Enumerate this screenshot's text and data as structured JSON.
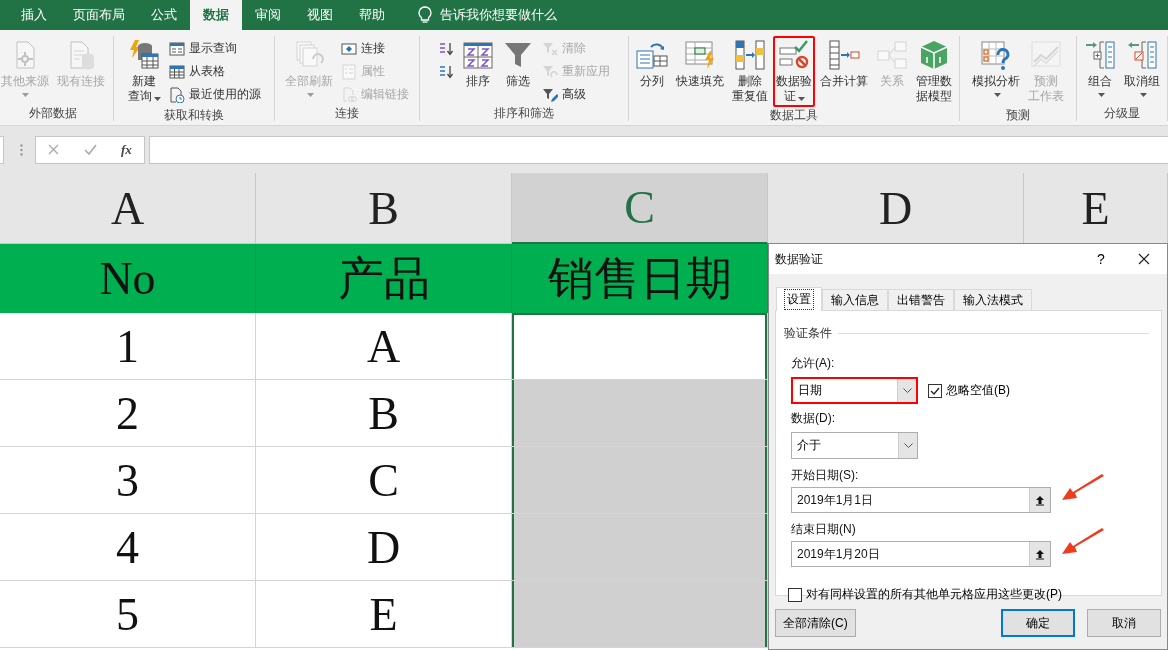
{
  "ribbon_tabs": [
    {
      "label": "插入",
      "selected": false
    },
    {
      "label": "页面布局",
      "selected": false
    },
    {
      "label": "公式",
      "selected": false
    },
    {
      "label": "数据",
      "selected": true
    },
    {
      "label": "审阅",
      "selected": false
    },
    {
      "label": "视图",
      "selected": false
    },
    {
      "label": "帮助",
      "selected": false
    }
  ],
  "tell_me": "告诉我你想要做什么",
  "ribbon_groups": [
    {
      "label": "外部数据",
      "items": [
        {
          "kind": "large",
          "label": "其他来源",
          "disabled": true,
          "dropdown": true,
          "highlighted": false
        },
        {
          "kind": "large",
          "label": "现有连接",
          "disabled": true,
          "dropdown": false,
          "highlighted": false
        }
      ]
    },
    {
      "label": "获取和转换",
      "items": [
        {
          "kind": "large",
          "label": "新建查询",
          "disabled": false,
          "dropdown": true,
          "highlighted": false
        },
        {
          "kind": "stack",
          "buttons": [
            {
              "label": "显示查询",
              "disabled": false
            },
            {
              "label": "从表格",
              "disabled": false
            },
            {
              "label": "最近使用的源",
              "disabled": false
            }
          ]
        }
      ]
    },
    {
      "label": "连接",
      "items": [
        {
          "kind": "large",
          "label": "全部刷新",
          "disabled": true,
          "dropdown": true,
          "highlighted": false
        },
        {
          "kind": "stack",
          "buttons": [
            {
              "label": "连接",
              "disabled": false
            },
            {
              "label": "属性",
              "disabled": true
            },
            {
              "label": "编辑链接",
              "disabled": true
            }
          ]
        }
      ]
    },
    {
      "label": "排序和筛选",
      "items": [
        {
          "kind": "stack",
          "buttons": [
            {
              "disabled": false
            },
            {
              "disabled": false
            }
          ]
        },
        {
          "kind": "large",
          "label": "排序",
          "disabled": false,
          "dropdown": false,
          "highlighted": false
        },
        {
          "kind": "large",
          "label": "筛选",
          "disabled": false,
          "dropdown": false,
          "highlighted": false
        },
        {
          "kind": "stack",
          "buttons": [
            {
              "label": "清除",
              "disabled": true
            },
            {
              "label": "重新应用",
              "disabled": true
            },
            {
              "label": "高级",
              "disabled": false
            }
          ]
        }
      ]
    },
    {
      "label": "数据工具",
      "items": [
        {
          "kind": "large",
          "label": "分列",
          "disabled": false,
          "dropdown": false,
          "highlighted": false
        },
        {
          "kind": "large",
          "label": "快速填充",
          "disabled": false,
          "dropdown": false,
          "highlighted": false
        },
        {
          "kind": "large",
          "label": "删除重复值",
          "disabled": false,
          "dropdown": false,
          "highlighted": false
        },
        {
          "kind": "large",
          "label": "数据验证",
          "disabled": false,
          "dropdown": true,
          "highlighted": true
        },
        {
          "kind": "large",
          "label": "合并计算",
          "disabled": false,
          "dropdown": false,
          "highlighted": false
        },
        {
          "kind": "large",
          "label": "关系",
          "disabled": true,
          "dropdown": false,
          "highlighted": false
        },
        {
          "kind": "large",
          "label": "管理数据模型",
          "disabled": false,
          "dropdown": false,
          "highlighted": false
        }
      ]
    },
    {
      "label": "预测",
      "items": [
        {
          "kind": "large",
          "label": "模拟分析",
          "disabled": false,
          "dropdown": true,
          "highlighted": false
        },
        {
          "kind": "large",
          "label": "预测工作表",
          "disabled": true,
          "dropdown": false,
          "highlighted": false
        }
      ]
    },
    {
      "label": "分级显",
      "items": [
        {
          "kind": "large",
          "label": "组合",
          "disabled": false,
          "dropdown": true,
          "highlighted": false
        },
        {
          "kind": "large",
          "label": "取消组",
          "disabled": false,
          "dropdown": true,
          "highlighted": false
        }
      ]
    }
  ],
  "formula_bar": {
    "function_label": "fx"
  },
  "columns": [
    {
      "label": "A",
      "selected": false
    },
    {
      "label": "B",
      "selected": false
    },
    {
      "label": "C",
      "selected": true
    },
    {
      "label": "D",
      "selected": false
    },
    {
      "label": "E",
      "selected": false
    }
  ],
  "header_row": [
    "No",
    "产品",
    "销售日期"
  ],
  "rows": [
    {
      "cells": [
        "1",
        "A"
      ],
      "active": true
    },
    {
      "cells": [
        "2",
        "B"
      ],
      "active": false
    },
    {
      "cells": [
        "3",
        "C"
      ],
      "active": false
    },
    {
      "cells": [
        "4",
        "D"
      ],
      "active": false
    },
    {
      "cells": [
        "5",
        "E"
      ],
      "active": false
    }
  ],
  "dialog": {
    "title": "数据验证",
    "help": "?",
    "tabs": [
      {
        "label": "设置",
        "selected": true
      },
      {
        "label": "输入信息",
        "selected": false
      },
      {
        "label": "出错警告",
        "selected": false
      },
      {
        "label": "输入法模式",
        "selected": false
      }
    ],
    "section": "验证条件",
    "allow": {
      "label": "允许(A):",
      "value": "日期",
      "highlighted": true
    },
    "ignore_blank": {
      "label": "忽略空值(B)",
      "checked": true
    },
    "data": {
      "label": "数据(D):",
      "value": "介于"
    },
    "ranges": [
      {
        "label": "开始日期(S):",
        "value": "2019年1月1日",
        "annotated": true
      },
      {
        "label": "结束日期(N)",
        "value": "2019年1月20日",
        "annotated": true
      }
    ],
    "apply_all": {
      "label": "对有同样设置的所有其他单元格应用这些更改(P)",
      "checked": false
    },
    "buttons": [
      {
        "label": "全部清除(C)",
        "default": false
      },
      {
        "label": "确定",
        "default": true
      },
      {
        "label": "取消",
        "default": false
      }
    ]
  }
}
